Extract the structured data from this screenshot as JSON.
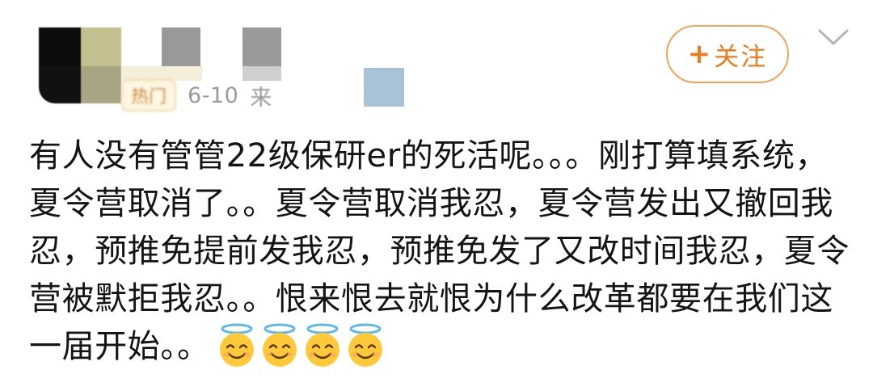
{
  "header": {
    "date": "6-10",
    "source_prefix": "来",
    "badge_text": "热门",
    "follow_button": {
      "icon": "plus-icon",
      "label": "关注"
    },
    "menu_icon": "chevron-down-icon"
  },
  "post": {
    "lines": [
      "有人没有管管22级保研er的死活呢。。。刚打算填系统，",
      "夏令营取消了。。夏令营取消我忍，夏令营发出又撤回我",
      "忍，预推免提前发我忍，预推免发了又改时间我忍，夏令",
      "营被默拒我忍。。恨来恨去就恨为什么改革都要在我们这",
      "一届开始。。"
    ],
    "trailing_emoji": "smiling-face-with-halo",
    "trailing_emoji_count": 4
  },
  "colors": {
    "accent": "#ee7b1e",
    "accent_border": "#f3a35a",
    "meta_text": "#9a9a9a",
    "body_text": "#141414"
  }
}
